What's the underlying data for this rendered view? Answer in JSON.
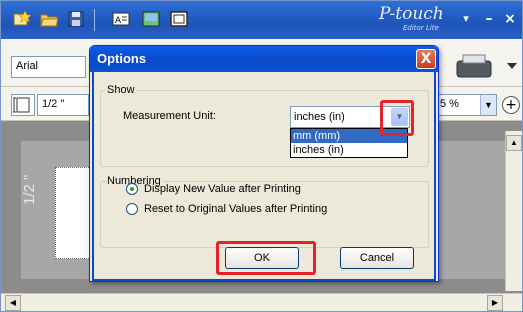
{
  "app": {
    "brand": "P-touch",
    "brand_sub": "Editor Lite",
    "font_name": "Arial",
    "tape_length": "1/2 \"",
    "zoom": "5 %",
    "canvas_label": "1/2 \""
  },
  "dialog": {
    "title": "Options",
    "close": "X",
    "show_group": "Show",
    "measurement_label": "Measurement Unit:",
    "measurement_value": "inches (in)",
    "measurement_options": [
      "mm (mm)",
      "inches (in)"
    ],
    "numbering_group": "Numbering",
    "radio_display": "Display New Value after Printing",
    "radio_reset": "Reset to Original Values after Printing",
    "ok": "OK",
    "cancel": "Cancel"
  },
  "colors": {
    "titlebar": "#1f55b8",
    "dialog_title": "#0a49c9",
    "highlight": "#e6232a",
    "selection": "#316ac5"
  },
  "icons": [
    "new-label-icon",
    "open-icon",
    "save-icon",
    "text-icon",
    "image-icon",
    "frame-icon",
    "minimize-icon",
    "close-icon",
    "printer-icon"
  ]
}
